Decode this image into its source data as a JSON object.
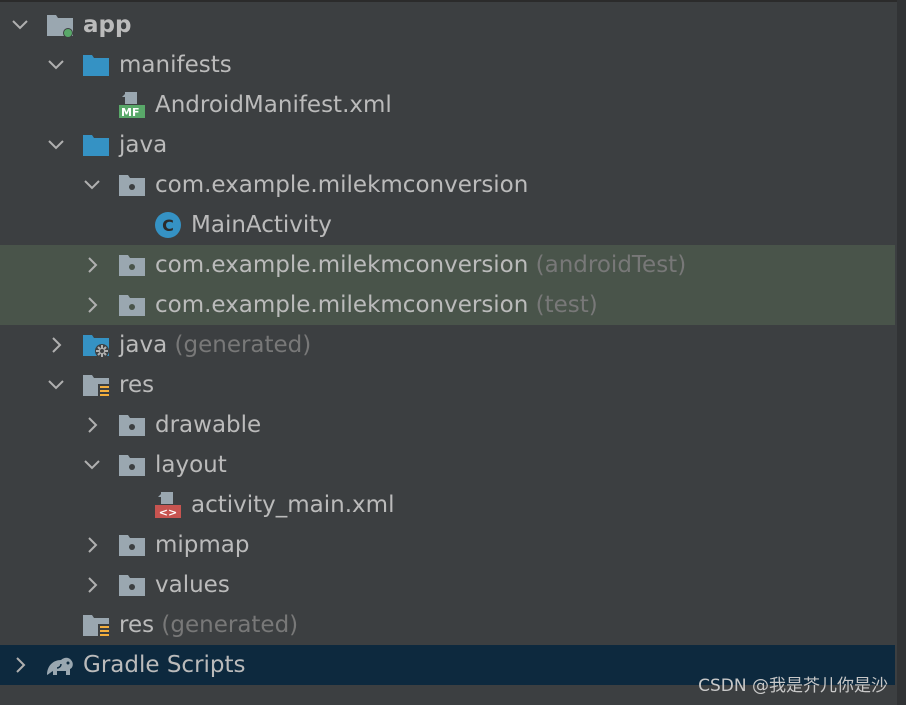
{
  "project_tree": {
    "rows": [
      {
        "label": "app",
        "suffix": "",
        "icon": "module-folder-icon",
        "expanded": true
      },
      {
        "label": "manifests",
        "suffix": "",
        "icon": "folder-icon",
        "expanded": true
      },
      {
        "label": "AndroidManifest.xml",
        "suffix": "",
        "icon": "manifest-file-icon",
        "badge": "MF"
      },
      {
        "label": "java",
        "suffix": "",
        "icon": "folder-icon",
        "expanded": true
      },
      {
        "label": "com.example.milekmconversion",
        "suffix": "",
        "icon": "package-icon",
        "expanded": true
      },
      {
        "label": "MainActivity",
        "suffix": "",
        "icon": "class-icon",
        "badge": "C"
      },
      {
        "label": "com.example.milekmconversion",
        "suffix": "(androidTest)",
        "icon": "package-icon",
        "expanded": false
      },
      {
        "label": "com.example.milekmconversion",
        "suffix": "(test)",
        "icon": "package-icon",
        "expanded": false
      },
      {
        "label": "java",
        "suffix": "(generated)",
        "icon": "generated-folder-icon",
        "expanded": false
      },
      {
        "label": "res",
        "suffix": "",
        "icon": "resources-folder-icon",
        "expanded": true
      },
      {
        "label": "drawable",
        "suffix": "",
        "icon": "package-icon",
        "expanded": false
      },
      {
        "label": "layout",
        "suffix": "",
        "icon": "package-icon",
        "expanded": true
      },
      {
        "label": "activity_main.xml",
        "suffix": "",
        "icon": "layout-xml-icon",
        "badge": "<>"
      },
      {
        "label": "mipmap",
        "suffix": "",
        "icon": "package-icon",
        "expanded": false
      },
      {
        "label": "values",
        "suffix": "",
        "icon": "package-icon",
        "expanded": false
      },
      {
        "label": "res",
        "suffix": "(generated)",
        "icon": "resources-folder-icon"
      },
      {
        "label": "Gradle Scripts",
        "suffix": "",
        "icon": "gradle-elephant-icon",
        "expanded": false
      }
    ]
  },
  "watermark": "CSDN @我是芥儿你是沙",
  "colors": {
    "background": "#3c3f41",
    "text": "#bbbbbb",
    "suffix_text": "#787878",
    "highlight_row": "#49544a",
    "selected_row": "#0d293e",
    "folder_blue": "#3592c4",
    "folder_gray": "#9aa7b0"
  }
}
